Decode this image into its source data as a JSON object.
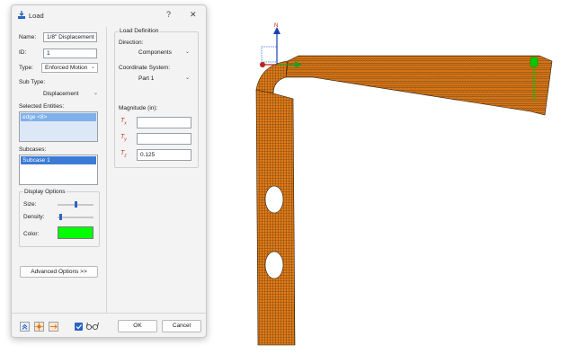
{
  "dialog": {
    "title": "Load",
    "help_glyph": "?",
    "close_glyph": "✕",
    "name_label": "Name:",
    "name_value": "1/8\" Displacement",
    "id_label": "ID:",
    "id_value": "1",
    "type_label": "Type:",
    "type_value": "Enforced Motion",
    "subtype_label": "Sub Type:",
    "subtype_value": "Displacement",
    "selected_label": "Selected Entities:",
    "selected_items": [
      "edge <8>"
    ],
    "subcases_label": "Subcases:",
    "subcase_items": [
      "Subcase 1"
    ],
    "display_options": {
      "title": "Display Options",
      "size_label": "Size:",
      "size_level": 0.5,
      "density_label": "Density:",
      "density_level": 0.05,
      "color_label": "Color:",
      "color": "#00ff00"
    },
    "advanced_button": "Advanced Options >>",
    "load_definition": {
      "title": "Load Definition",
      "direction_label": "Direction:",
      "direction_value": "Components",
      "coord_label": "Coordinate System:",
      "coord_value": "Part 1",
      "magnitude_label": "Magnitude (in):",
      "tx_label": "T",
      "tx_sub": "x",
      "tx_value": "",
      "ty_label": "T",
      "ty_sub": "y",
      "ty_value": "",
      "tz_label": "T",
      "tz_sub": "z",
      "tz_value": "0.125"
    },
    "ok_button": "OK",
    "cancel_button": "Cancel",
    "glasses_checked": true
  },
  "viewport": {
    "triad_label": "N",
    "mesh_color": "#e07a18",
    "mesh_line_color": "#3a2a10",
    "marker_color": "#00cc00"
  }
}
